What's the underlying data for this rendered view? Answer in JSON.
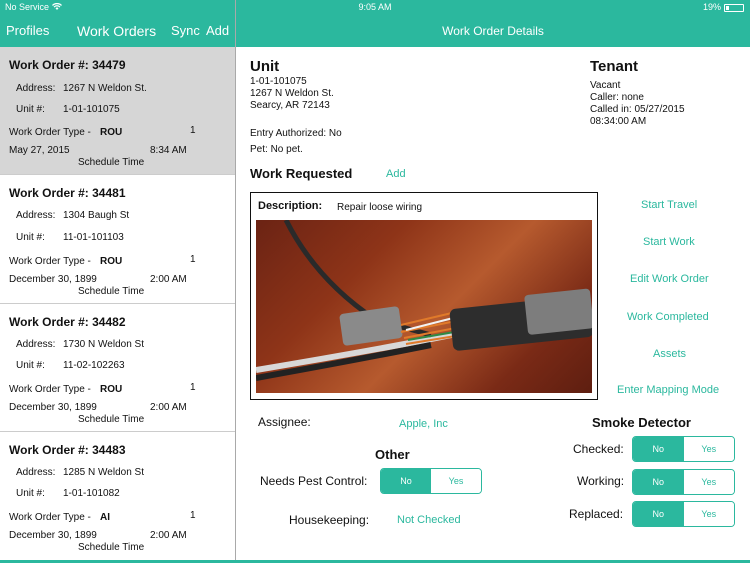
{
  "status": {
    "carrier": "No Service",
    "time": "9:05 AM",
    "battery": "19%"
  },
  "sidebar_nav": {
    "profiles": "Profiles",
    "title": "Work Orders",
    "sync": "Sync",
    "add": "Add"
  },
  "detail_nav": {
    "title": "Work Order Details"
  },
  "work_orders": [
    {
      "number": "Work Order #: 34479",
      "address_label": "Address:",
      "address": "1267 N Weldon St.",
      "unit_label": "Unit #:",
      "unit": "1-01-101075",
      "type_label": "Work Order Type -",
      "type": "ROU",
      "count": "1",
      "date": "May 27, 2015",
      "time": "8:34 AM",
      "schedule": "Schedule Time"
    },
    {
      "number": "Work Order #: 34481",
      "address_label": "Address:",
      "address": "1304 Baugh St",
      "unit_label": "Unit #:",
      "unit": "11-01-101103",
      "type_label": "Work Order Type -",
      "type": "ROU",
      "count": "1",
      "date": "December 30, 1899",
      "time": "2:00 AM",
      "schedule": "Schedule Time"
    },
    {
      "number": "Work Order #: 34482",
      "address_label": "Address:",
      "address": "1730 N Weldon St",
      "unit_label": "Unit #:",
      "unit": "11-02-102263",
      "type_label": "Work Order Type -",
      "type": "ROU",
      "count": "1",
      "date": "December 30, 1899",
      "time": "2:00 AM",
      "schedule": "Schedule Time"
    },
    {
      "number": "Work Order #: 34483",
      "address_label": "Address:",
      "address": "1285 N Weldon St",
      "unit_label": "Unit #:",
      "unit": "1-01-101082",
      "type_label": "Work Order Type -",
      "type": "AI",
      "count": "1",
      "date": "December 30, 1899",
      "time": "2:00 AM",
      "schedule": "Schedule Time"
    }
  ],
  "unit": {
    "heading": "Unit",
    "line1": "1-01-101075",
    "line2": "1267 N Weldon St.",
    "line3": "Searcy, AR 72143",
    "entry": "Entry Authorized: No",
    "pet": "Pet:  No pet."
  },
  "tenant": {
    "heading": "Tenant",
    "line1": "Vacant",
    "line2": "Caller: none",
    "line3": "Called in: 05/27/2015",
    "line4": "08:34:00 AM"
  },
  "work_requested": {
    "heading": "Work Requested",
    "add": "Add",
    "desc_label": "Description:",
    "desc": "Repair loose wiring"
  },
  "actions": [
    "Start Travel",
    "Start Work",
    "Edit Work Order",
    "Work Completed",
    "Assets",
    "Enter Mapping Mode"
  ],
  "assignee": {
    "label": "Assignee:",
    "value": "Apple, Inc"
  },
  "other": {
    "heading": "Other",
    "pest_label": "Needs Pest Control:",
    "housekeeping_label": "Housekeeping:",
    "housekeeping_value": "Not Checked"
  },
  "smoke": {
    "heading": "Smoke Detector",
    "checked": "Checked:",
    "working": "Working:",
    "replaced": "Replaced:"
  },
  "toggle": {
    "no": "No",
    "yes": "Yes"
  },
  "colors": {
    "accent": "#2bb89e",
    "selected_row": "#d6d6d6"
  }
}
